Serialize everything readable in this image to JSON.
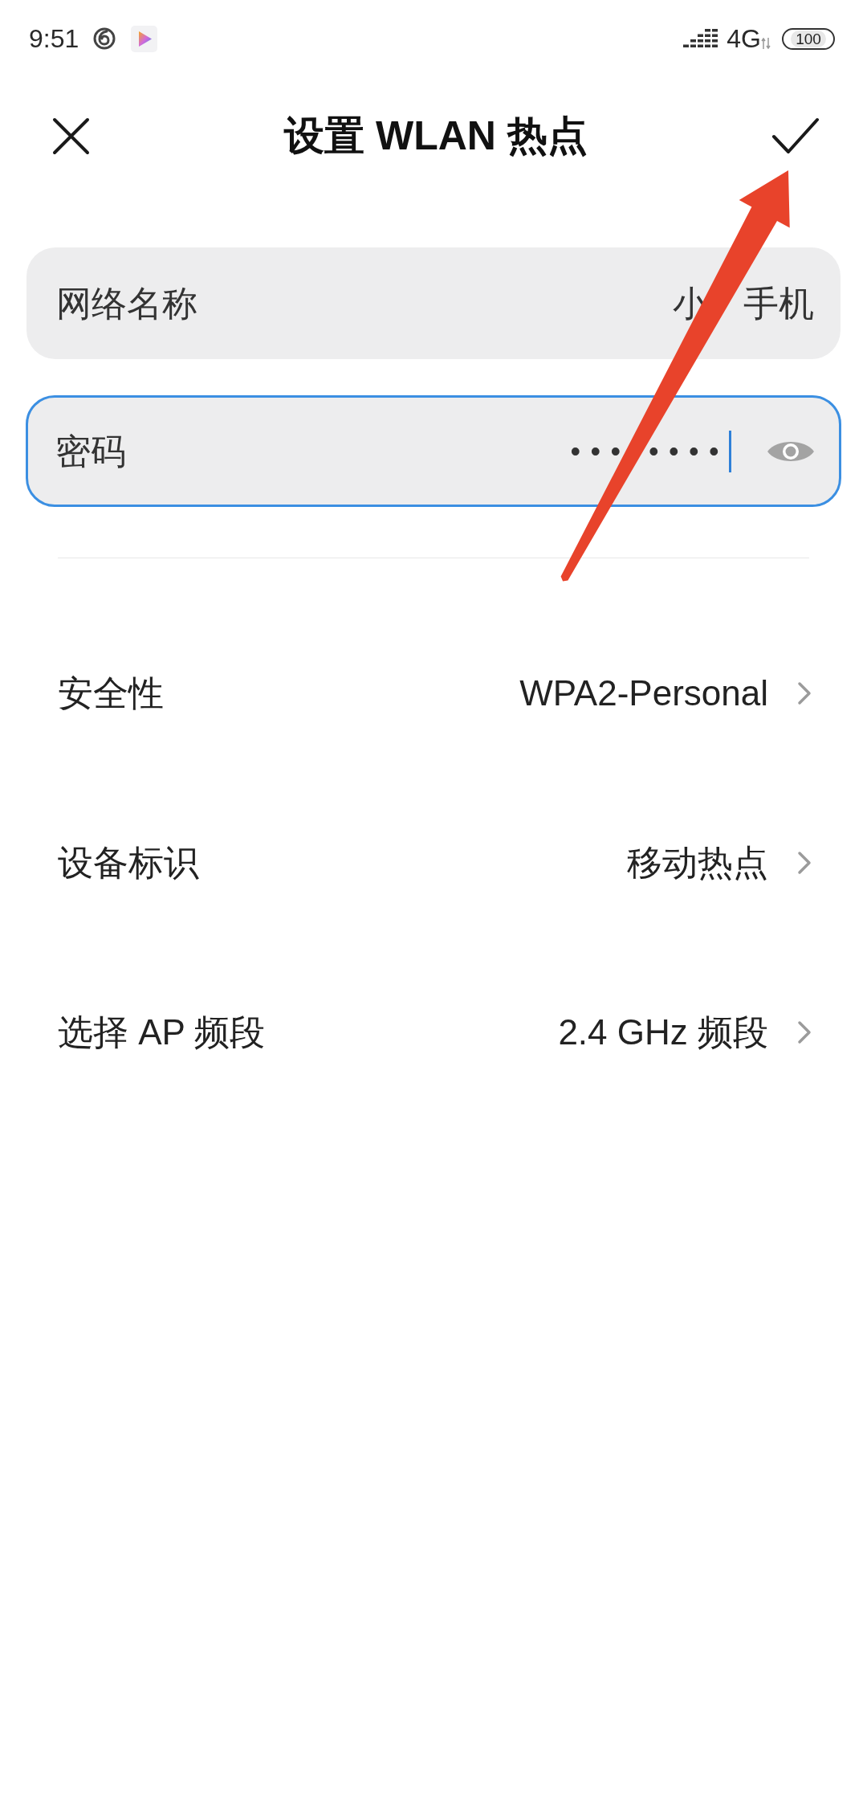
{
  "status_bar": {
    "time": "9:51",
    "network": "4G",
    "battery": "100"
  },
  "header": {
    "title": "设置 WLAN 热点"
  },
  "fields": [
    {
      "kind": "text",
      "label": "网络名称",
      "value": "小　手机",
      "focused": false
    },
    {
      "kind": "password",
      "label": "密码",
      "value": "••• ••••",
      "focused": true
    }
  ],
  "settings": [
    {
      "label": "安全性",
      "value": "WPA2-Personal"
    },
    {
      "label": "设备标识",
      "value": "移动热点"
    },
    {
      "label": "选择 AP 频段",
      "value": "2.4 GHz 频段"
    }
  ]
}
